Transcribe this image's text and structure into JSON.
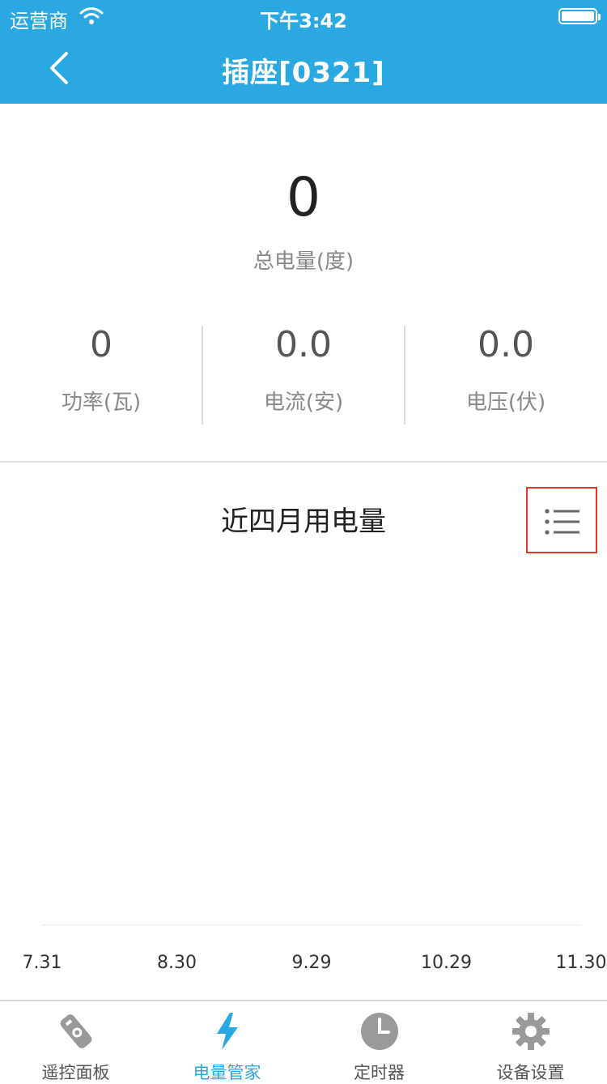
{
  "status_bar": {
    "carrier": "运营商",
    "time": "下午3:42"
  },
  "nav": {
    "title": "插座[0321]",
    "back_icon": "chevron-left-icon"
  },
  "summary": {
    "total_value": "0",
    "total_label": "总电量(度)"
  },
  "metrics": [
    {
      "value": "0",
      "label": "功率(瓦)"
    },
    {
      "value": "0.0",
      "label": "电流(安)"
    },
    {
      "value": "0.0",
      "label": "电压(伏)"
    }
  ],
  "chart_data": {
    "type": "line",
    "title": "近四月用电量",
    "x": [
      "7.31",
      "8.30",
      "9.29",
      "10.29",
      "11.30"
    ],
    "series": []
  },
  "chart_controls": {
    "list_icon": "list-icon",
    "highlight_color": "#e23a2a"
  },
  "tabs": [
    {
      "label": "遥控面板",
      "icon": "remote-icon",
      "active": false
    },
    {
      "label": "电量管家",
      "icon": "lightning-icon",
      "active": true
    },
    {
      "label": "定时器",
      "icon": "clock-icon",
      "active": false
    },
    {
      "label": "设备设置",
      "icon": "gear-icon",
      "active": false
    }
  ],
  "colors": {
    "primary": "#29a8e2",
    "tab_inactive": "#9a9a9a"
  }
}
